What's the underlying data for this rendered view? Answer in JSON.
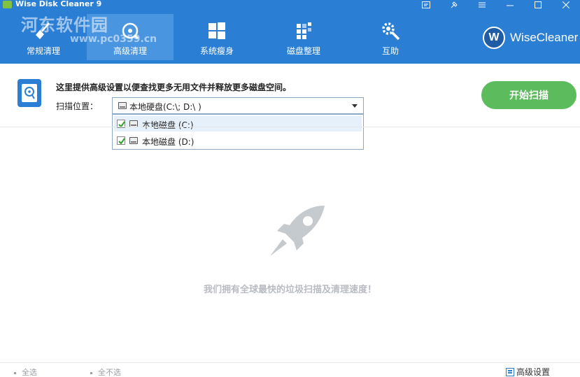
{
  "window": {
    "title": "Wise Disk Cleaner 9"
  },
  "watermark": {
    "text": "河东软件园",
    "url": "www.pc0359.cn"
  },
  "nav": {
    "items": [
      {
        "label": "常规清理",
        "icon": "broom-icon"
      },
      {
        "label": "高级清理",
        "icon": "disk-scan-icon"
      },
      {
        "label": "系统瘦身",
        "icon": "windows-icon"
      },
      {
        "label": "磁盘整理",
        "icon": "defrag-icon"
      },
      {
        "label": "互助",
        "icon": "tools-icon"
      }
    ],
    "active_index": 1
  },
  "brand": {
    "badge": "W",
    "name": "WiseCleaner"
  },
  "panel": {
    "description": "这里提供高级设置以便查找更多无用文件并释放更多磁盘空间。",
    "scan_label": "扫描位置：",
    "combo_value": "本地硬盘(C:\\; D:\\ )",
    "drives": [
      {
        "label": "本地磁盘 (C:)",
        "checked": true
      },
      {
        "label": "本地磁盘 (D:)",
        "checked": true
      }
    ],
    "start_button": "开始扫描"
  },
  "empty_state": {
    "slogan": "我们拥有全球最快的垃圾扫描及清理速度！"
  },
  "footer": {
    "select_all": "全选",
    "select_none": "全不选",
    "advanced_settings": "高级设置"
  },
  "colors": {
    "header": "#2a7fd4",
    "active_tab": "#4a95e0",
    "start_button": "#5cbb5c"
  }
}
